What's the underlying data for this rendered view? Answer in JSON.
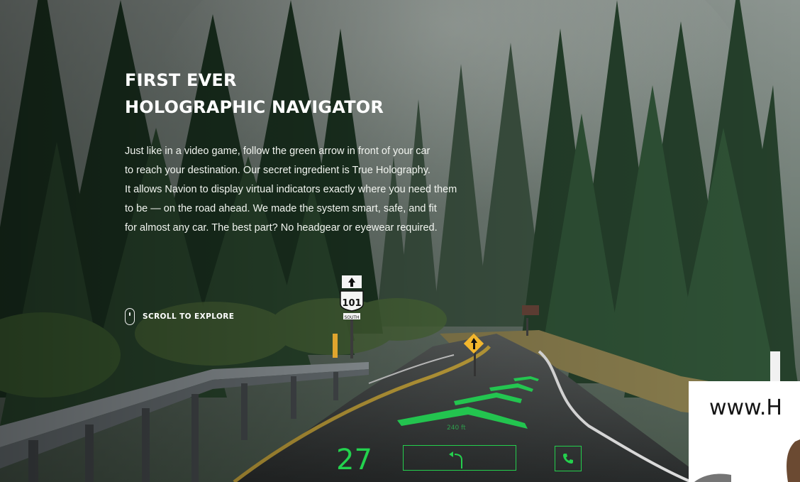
{
  "hero": {
    "heading_line1": "FIRST EVER",
    "heading_line2": "HOLOGRAPHIC NAVIGATOR",
    "body_lines": [
      "Just like in a video game, follow the green arrow in front of your car",
      "to reach your destination. Our secret ingredient is True Holography.",
      "It allows Navion to display virtual indicators exactly where you need them",
      "to be — on the road ahead. We made the system smart, safe, and fit",
      "for almost any car. The best part? No headgear or eyewear required."
    ],
    "scroll_cta": "SCROLL TO EXPLORE",
    "scroll_icon": "mouse-icon"
  },
  "road_sign": {
    "route_number": "101",
    "direction": "SOUTH"
  },
  "hud": {
    "speed": "27",
    "distance": "240 ft",
    "phone_icon": "phone-icon",
    "turn_icon": "turn-arrow-icon",
    "color": "#23d24e"
  },
  "overlay": {
    "text": "www.H"
  }
}
